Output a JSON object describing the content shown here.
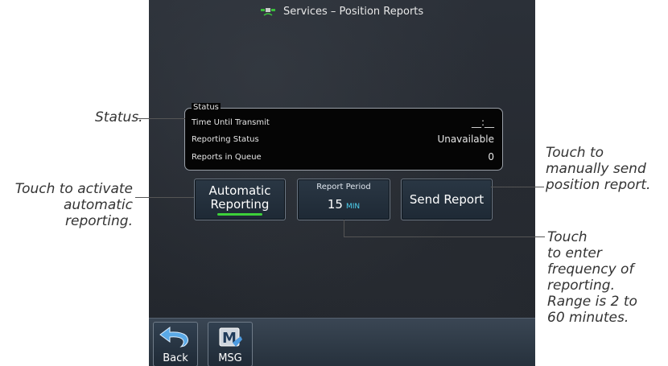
{
  "title": "Services – Position Reports",
  "status": {
    "legend": "Status",
    "rows": [
      {
        "label": "Time Until Transmit",
        "value": "__:__"
      },
      {
        "label": "Reporting Status",
        "value": "Unavailable"
      },
      {
        "label": "Reports in Queue",
        "value": "0"
      }
    ]
  },
  "buttons": {
    "automatic": {
      "line1": "Automatic",
      "line2": "Reporting"
    },
    "period": {
      "label": "Report Period",
      "value": "15",
      "unit": "MIN"
    },
    "send": {
      "label": "Send Report"
    }
  },
  "bottom": {
    "back": "Back",
    "msg": "MSG"
  },
  "annotations": {
    "status": "Status.",
    "automatic": [
      "Touch to activate",
      "automatic",
      "reporting."
    ],
    "send": [
      "Touch to",
      "manually send",
      "position report."
    ],
    "period": [
      "Touch",
      "to enter",
      "frequency of",
      "reporting.",
      "Range is 2 to",
      "60 minutes."
    ]
  },
  "colors": {
    "active_bar": "#3dd13a",
    "unit": "#4fd3f2"
  }
}
